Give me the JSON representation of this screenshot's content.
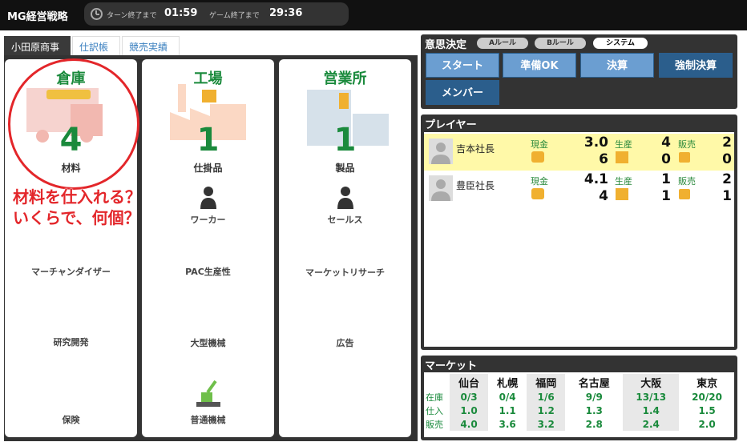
{
  "app": {
    "title": "MG経営戦略"
  },
  "timer": {
    "turn_label": "ターン終了まで",
    "turn_value": "01:59",
    "game_label": "ゲーム終了まで",
    "game_value": "29:36"
  },
  "tabs": [
    {
      "label": "小田原商事"
    },
    {
      "label": "仕訳帳"
    },
    {
      "label": "競売実績"
    }
  ],
  "columns": {
    "warehouse": {
      "title": "倉庫",
      "count": "4",
      "unit": "材料",
      "items": [
        "マーチャンダイザー",
        "研究開発",
        "保険"
      ]
    },
    "factory": {
      "title": "工場",
      "count": "1",
      "unit": "仕掛品",
      "worker": "ワーカー",
      "items": [
        "PAC生産性",
        "大型機械",
        "普通機械"
      ]
    },
    "office": {
      "title": "営業所",
      "count": "1",
      "unit": "製品",
      "sales": "セールス",
      "items": [
        "マーケットリサーチ",
        "広告"
      ]
    }
  },
  "annotation": {
    "line1": "材料を仕入れる？",
    "line2": "いくらで、何個？"
  },
  "decision": {
    "title": "意思決定",
    "pills": [
      "Aルール",
      "Bルール",
      "システム"
    ],
    "active_pill": "システム",
    "buttons": [
      "スタート",
      "準備OK",
      "決算",
      "強制決算",
      "メンバー"
    ]
  },
  "players": {
    "title": "プレイヤー",
    "rows": [
      {
        "name": "吉本社長",
        "cash_label": "現金",
        "cash": "3.0",
        "coins": "6",
        "prod_label": "生産",
        "prod": "4",
        "boxes": "0",
        "sales_label": "販売",
        "sales": "2",
        "tags": "0",
        "highlight": true
      },
      {
        "name": "豊臣社長",
        "cash_label": "現金",
        "cash": "4.1",
        "coins": "4",
        "prod_label": "生産",
        "prod": "1",
        "boxes": "1",
        "sales_label": "販売",
        "sales": "2",
        "tags": "1",
        "highlight": false
      }
    ]
  },
  "market": {
    "title": "マーケット",
    "cities": [
      "仙台",
      "札幌",
      "福岡",
      "名古屋",
      "大阪",
      "東京"
    ],
    "rows": [
      {
        "label": "在庫",
        "values": [
          "0/3",
          "0/4",
          "1/6",
          "9/9",
          "13/13",
          "20/20"
        ]
      },
      {
        "label": "仕入",
        "values": [
          "1.0",
          "1.1",
          "1.2",
          "1.3",
          "1.4",
          "1.5"
        ]
      },
      {
        "label": "販売",
        "values": [
          "4.0",
          "3.6",
          "3.2",
          "2.8",
          "2.4",
          "2.0"
        ]
      }
    ]
  },
  "colors": {
    "accent_green": "#1a8a3c",
    "annotation_red": "#e3262a",
    "button_blue": "#6b9ed1",
    "button_dark": "#2b5e8c",
    "highlight": "#fff9a8"
  }
}
